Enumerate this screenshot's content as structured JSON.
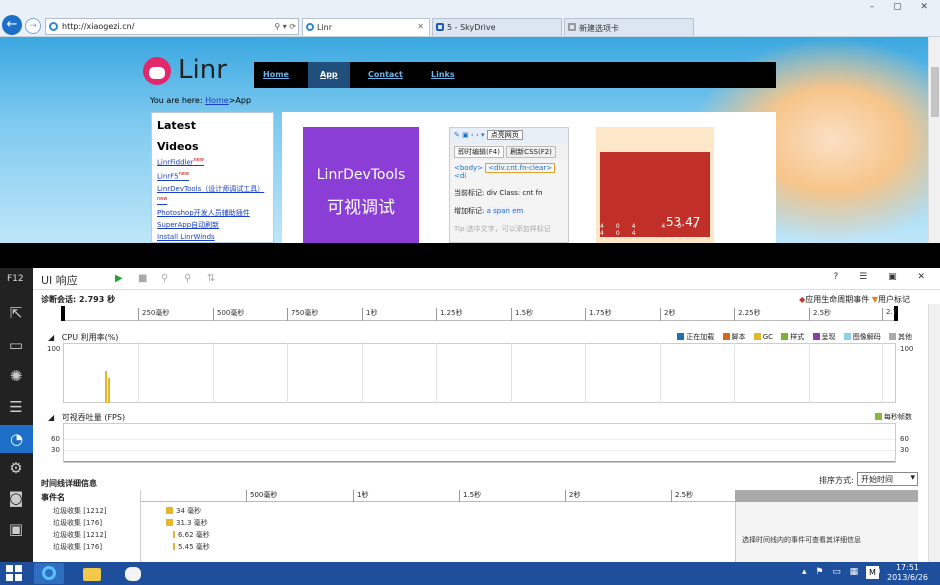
{
  "browser": {
    "url": "http://xiaogezi.cn/",
    "tabs": [
      {
        "label": "Linr",
        "active": true
      },
      {
        "label": "5 - SkyDrive",
        "active": false
      },
      {
        "label": "新建选项卡",
        "active": false
      }
    ],
    "controls": "– ▢ ✕"
  },
  "site": {
    "logo_text": "Linr",
    "nav": [
      {
        "label": "Home",
        "active": false
      },
      {
        "label": "App",
        "active": true
      },
      {
        "label": "Contact",
        "active": false
      },
      {
        "label": "Links",
        "active": false
      }
    ],
    "breadcrumb_prefix": "You are here:",
    "breadcrumb_home": "Home",
    "breadcrumb_current": ">App",
    "sidebar": {
      "heading1": "Latest",
      "heading2": "Videos",
      "links": [
        "LinrFiddler",
        "LinrF5",
        "LinrDevTools（设计师调试工具）",
        "Photoshop开发人员辅助插件",
        "SuperApp自动刷新",
        "Install LinrWinds"
      ],
      "new_badge": "new"
    },
    "promo": {
      "line1": "LinrDevTools",
      "line2": "可视调试"
    },
    "shot": {
      "btn_open": "点亮网页",
      "tab1": "即时编辑(F4)",
      "tab2": "刷新CSS(F2)",
      "tag_body": "<body>",
      "tag_div": "<div.cnt.fn-clear>",
      "tag_more": "<di",
      "cur_label": "当前标记:",
      "cur_val": "div",
      "class_label": "Class:",
      "class_val": "cnt fn",
      "add_label": "增加标记:",
      "add_tags": [
        "a",
        "span",
        "em"
      ],
      "tip": "Tip:选中文字，可以添加样标记"
    },
    "shot2_number": "53.47",
    "shot2_small": [
      "404",
      "404",
      "404"
    ]
  },
  "devtools": {
    "f12_label": "F12",
    "title": "UI 响应",
    "session": "诊断会话: 2.793 秒",
    "legend_lifecycle": "应用生命周期事件",
    "legend_user": "用户标记",
    "ruler_ticks": [
      "250毫秒",
      "500毫秒",
      "750毫秒",
      "1秒",
      "1.25秒",
      "1.5秒",
      "1.75秒",
      "2秒",
      "2.25秒",
      "2.5秒",
      "2.7"
    ],
    "cpu": {
      "title": "CPU 利用率(%)",
      "y_max": "100",
      "legend": [
        {
          "label": "正在加载",
          "color": "#1f6fb7"
        },
        {
          "label": "脚本",
          "color": "#d66a1c"
        },
        {
          "label": "GC",
          "color": "#e3b62e"
        },
        {
          "label": "样式",
          "color": "#7cb32b"
        },
        {
          "label": "呈现",
          "color": "#8c3fa6"
        },
        {
          "label": "图像解码",
          "color": "#8fd0ec"
        },
        {
          "label": "其他",
          "color": "#aaaaaa"
        }
      ]
    },
    "fps": {
      "title": "可视吞吐量 (FPS)",
      "legend": "每秒帧数",
      "legend_color": "#8ab832",
      "y60": "60",
      "y30": "30"
    },
    "timeline": {
      "title": "时间线详细信息",
      "sort_label": "排序方式:",
      "sort_value": "开始时间",
      "event_col": "事件名",
      "ticks": [
        "500毫秒",
        "1秒",
        "1.5秒",
        "2秒",
        "2.5秒"
      ],
      "events": [
        {
          "name": "垃圾收集 [1212]",
          "duration": "34 毫秒"
        },
        {
          "name": "垃圾收集 [176]",
          "duration": "31.3 毫秒"
        },
        {
          "name": "垃圾收集 [1212]",
          "duration": "6.62 毫秒"
        },
        {
          "name": "垃圾收集 [176]",
          "duration": "5.45 毫秒"
        }
      ],
      "detail_hint": "选择时间线内的事件可查看其详细信息"
    }
  },
  "taskbar": {
    "time": "17:51",
    "date": "2013/6/26",
    "ime": "M"
  }
}
